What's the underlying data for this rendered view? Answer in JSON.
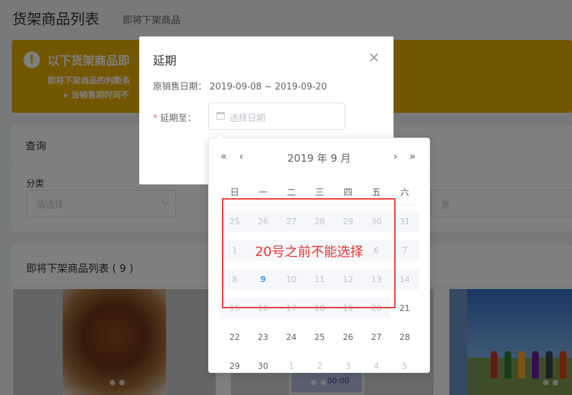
{
  "page": {
    "title": "货架商品列表",
    "subtitle": "即将下架商品"
  },
  "alert": {
    "title": "以下货架商品即",
    "desc": "即将下架商品的判断条",
    "item": "当销售期时间不"
  },
  "query": {
    "title": "查询",
    "category_label": "分类",
    "category_placeholder": "请选择",
    "right_placeholder": "息"
  },
  "list": {
    "title": "即将下架商品列表 ( 9 )",
    "phone_text": "00:00"
  },
  "dialog": {
    "title": "延期",
    "close_icon": "close-icon",
    "original_label": "原销售日期：",
    "original_range": "2019-09-08 ~ 2019-09-20",
    "required_mark": "*",
    "extend_label": "延期至：",
    "date_placeholder": "选择日期"
  },
  "picker": {
    "header": "2019 年  9 月",
    "prev_year": "«",
    "prev_month": "‹",
    "next_month": "›",
    "next_year": "»",
    "weekdays": [
      "日",
      "一",
      "二",
      "三",
      "四",
      "五",
      "六"
    ],
    "weeks": [
      [
        "25",
        "26",
        "27",
        "28",
        "29",
        "30",
        "31"
      ],
      [
        "1",
        "2",
        "3",
        "4",
        "5",
        "6",
        "7"
      ],
      [
        "8",
        "9",
        "10",
        "11",
        "12",
        "13",
        "14"
      ],
      [
        "15",
        "16",
        "17",
        "18",
        "19",
        "20",
        "21"
      ],
      [
        "22",
        "23",
        "24",
        "25",
        "26",
        "27",
        "28"
      ],
      [
        "29",
        "30",
        "1",
        "2",
        "3",
        "4",
        "5"
      ]
    ],
    "today": "9",
    "accent": "#409eff"
  },
  "annotation": {
    "text": "20号之前不能选择",
    "color": "#e53935"
  }
}
